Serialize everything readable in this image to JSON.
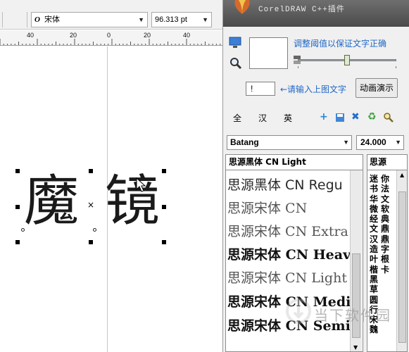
{
  "property_bar": {
    "font_name": "宋体",
    "font_size": "96.313 pt"
  },
  "ruler": {
    "labels": [
      "40",
      "20",
      "0",
      "20",
      "40"
    ]
  },
  "canvas": {
    "art_text": "魔 镜"
  },
  "plugin": {
    "banner_title": "CorelDRAW C++插件",
    "threshold_label": "调整阈值以保证文字正确",
    "threshold_value": 0.5,
    "char_input_value": "!",
    "input_hint": "←请输入上图文字",
    "demo_button": "动画演示",
    "lang_tabs": [
      "全",
      "汉",
      "英"
    ],
    "action_icons": [
      "add-icon",
      "save-icon",
      "delete-icon",
      "refresh-icon",
      "search-icon"
    ],
    "font_select": "Batang",
    "size_select": "24.000",
    "font_list": {
      "header": "思源黑体 CN Light",
      "items": [
        {
          "text": "思源黑体 CN Regu",
          "style": "sans"
        },
        {
          "text": "思源宋体 CN",
          "style": "light serif"
        },
        {
          "text": "思源宋体 CN Extra",
          "style": "light serif"
        },
        {
          "text": "思源宋体 CN Heav",
          "style": "bold serif"
        },
        {
          "text": "思源宋体 CN Light",
          "style": "light serif"
        },
        {
          "text": "思源宋体 CN Medi",
          "style": "bold serif"
        },
        {
          "text": "思源宋体 CN Semi",
          "style": "bold serif"
        }
      ]
    },
    "char_panel": {
      "header": "思源",
      "col1": "迷书华微经文汉造叶楷黑草圆行宋魏",
      "col2": "你法文软典鼎鼎字根卡"
    },
    "watermark": "当下软件园"
  }
}
